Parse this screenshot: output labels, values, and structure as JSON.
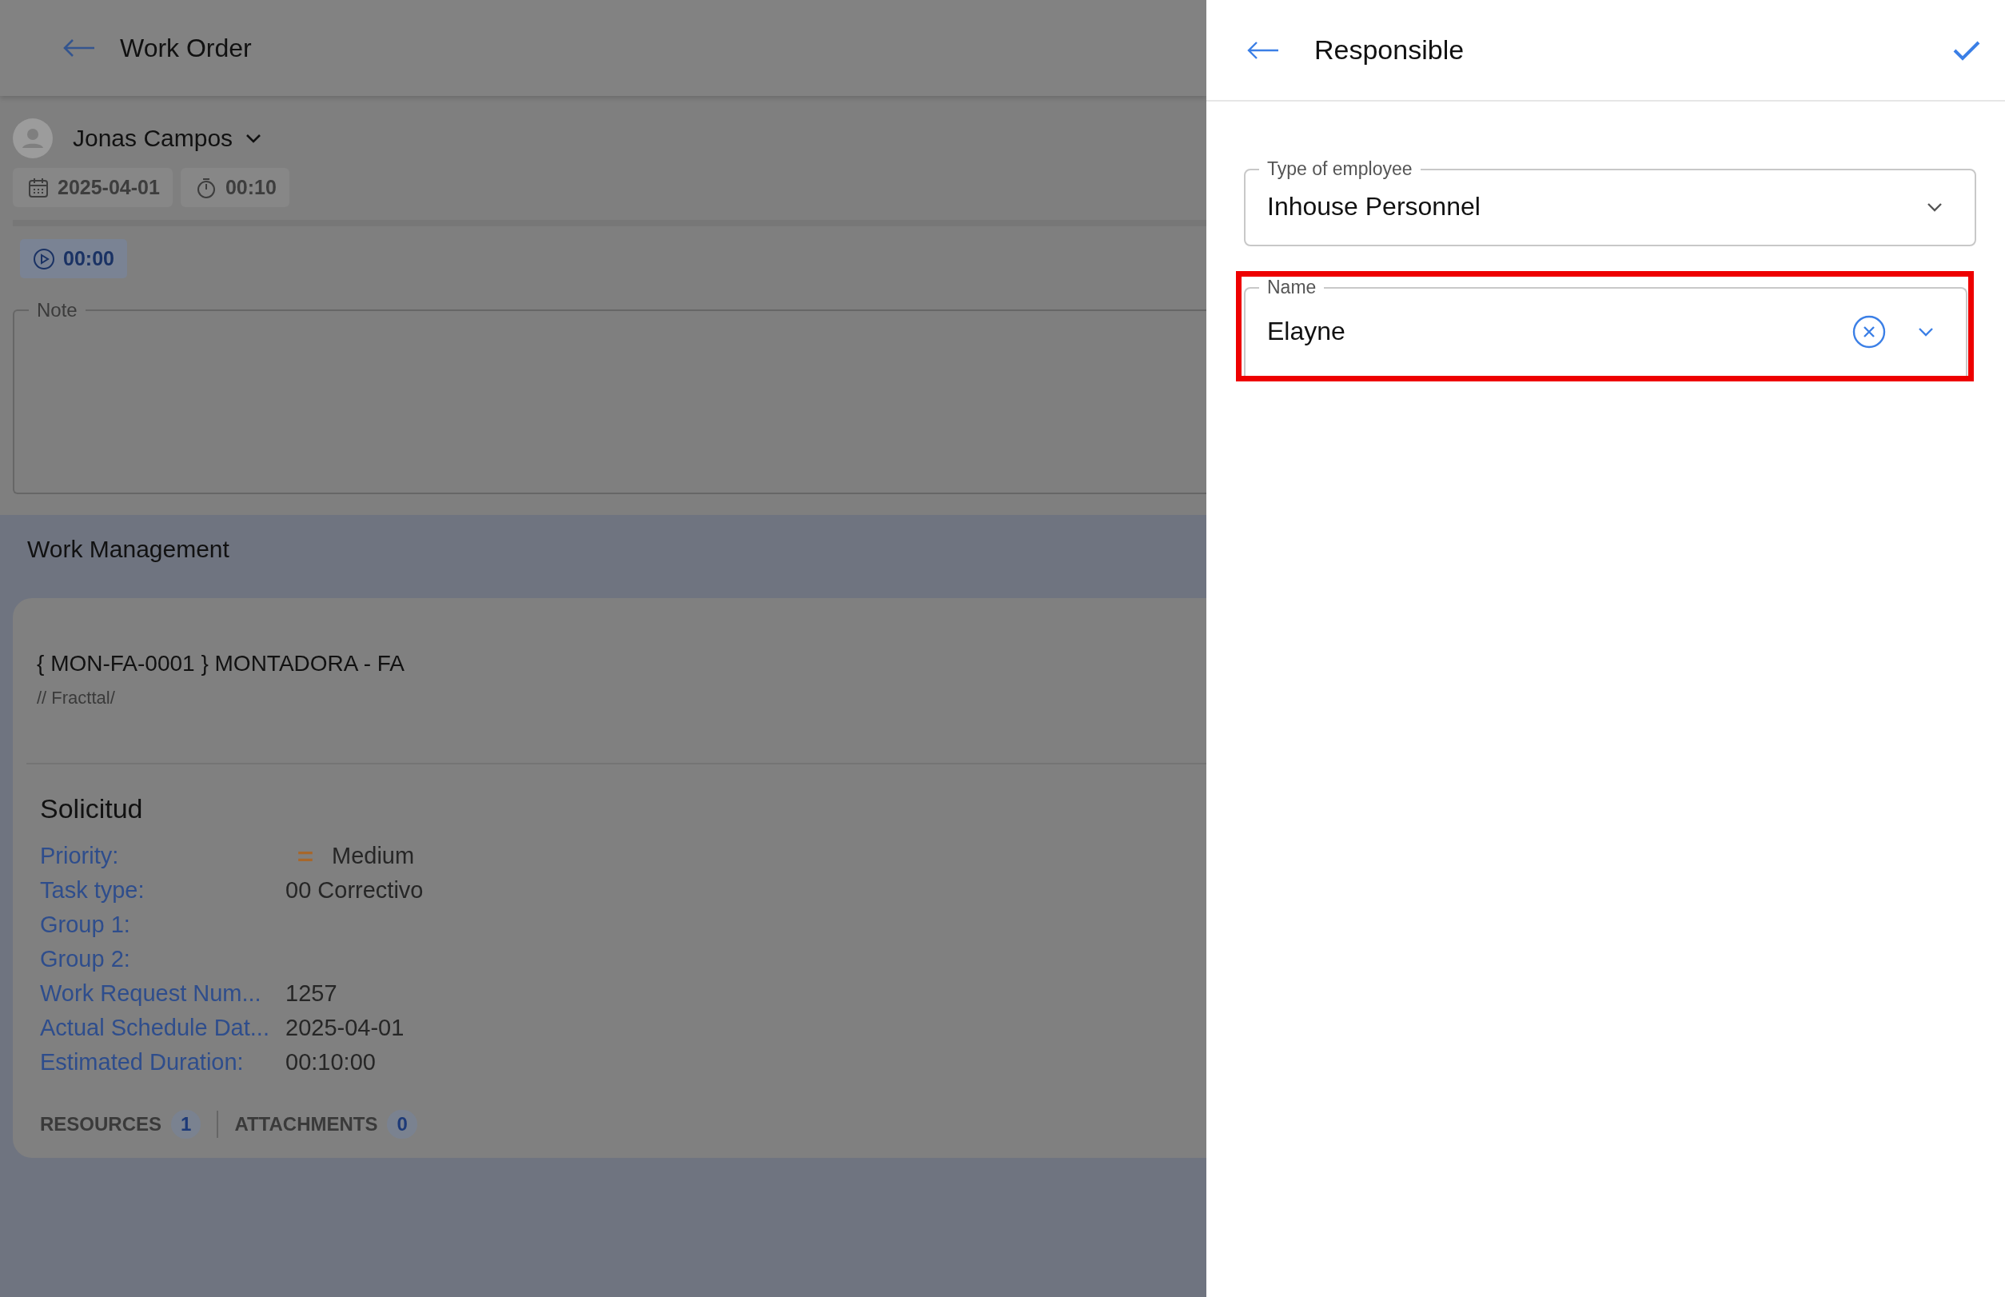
{
  "background_page": {
    "header": {
      "title": "Work Order"
    },
    "user": {
      "name": "Jonas Campos"
    },
    "chips": [
      {
        "kind": "date",
        "text": "2025-04-01"
      },
      {
        "kind": "duration",
        "text": "00:10"
      }
    ],
    "timer": {
      "text": "00:00"
    },
    "note": {
      "label": "Note"
    },
    "section_title": "Work Management",
    "asset": {
      "title": "{ MON-FA-0001 } MONTADORA - FA",
      "path": "// Fracttal/"
    },
    "request": {
      "title": "Solicitud",
      "fields": [
        {
          "kind": "priority",
          "label": "Priority:",
          "value": "Medium"
        },
        {
          "kind": "text",
          "label": "Task type:",
          "value": "00 Correctivo"
        },
        {
          "kind": "text",
          "label": "Group 1:"
        },
        {
          "kind": "text",
          "label": "Group 2:"
        },
        {
          "kind": "text",
          "label": "Work Request Num...",
          "value": "1257"
        },
        {
          "kind": "text",
          "label": "Actual Schedule Dat...",
          "value": "2025-04-01"
        },
        {
          "kind": "text",
          "label": "Estimated Duration:",
          "value": "00:10:00"
        }
      ]
    },
    "tabs": [
      {
        "label": "RESOURCES",
        "count": "1"
      },
      {
        "label": "ATTACHMENTS",
        "count": "0"
      }
    ]
  },
  "panel": {
    "title": "Responsible",
    "fields": [
      {
        "label": "Type of employee",
        "value": "Inhouse Personnel",
        "clearable": false,
        "highlighted": false
      },
      {
        "label": "Name",
        "value": "Elayne",
        "clearable": true,
        "highlighted": true
      }
    ]
  }
}
